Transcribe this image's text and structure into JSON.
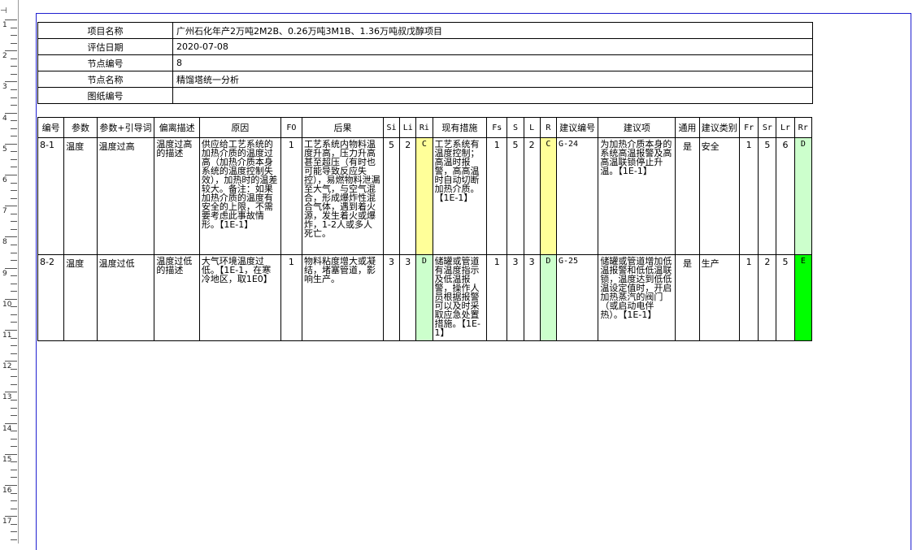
{
  "header": {
    "rows": [
      {
        "label": "项目名称",
        "value": "广州石化年产2万吨2M2B、0.26万吨3M1B、1.36万吨叔戊醇项目"
      },
      {
        "label": "评估日期",
        "value": "2020-07-08"
      },
      {
        "label": "节点编号",
        "value": "8"
      },
      {
        "label": "节点名称",
        "value": "精馏塔统一分析"
      },
      {
        "label": "图纸编号",
        "value": ""
      }
    ]
  },
  "columns": [
    "编号",
    "参数",
    "参数+引导词",
    "偏离描述",
    "原因",
    "FO",
    "后果",
    "Si",
    "Li",
    "Ri",
    "现有措施",
    "Fs",
    "S",
    "L",
    "R",
    "建议编号",
    "建议项",
    "通用",
    "建议类别",
    "Fr",
    "Sr",
    "Lr",
    "Rr"
  ],
  "rows": [
    {
      "id": "8-1",
      "param": "温度",
      "guide": "温度过高",
      "deviation": "温度过高的描述",
      "cause": "供应给工艺系统的加热介质的温度过高（加热介质本身系统的温度控制失效），加热时的温差较大。备注：如果加热介质的温度有安全的上限，不需要考虑此事故情形。【1E-1】",
      "fo": "1",
      "consequence": "工艺系统内物料温度升高，压力升高甚至超压（有时也可能导致反应失控），易燃物料泄漏至大气，与空气混合，形成爆炸性混合气体，遇到着火源，发生着火或爆炸，1-2人或多人死亡。",
      "si": "5",
      "li": "2",
      "ri": "C",
      "measures": "工艺系统有温度控制；高温时报警，高高温时自动切断加热介质。【1E-1】",
      "fs": "1",
      "s": "5",
      "l": "2",
      "r": "C",
      "sugg_no": "G-24",
      "sugg": "为加热介质本身的系统高温报警及高高温联锁停止升温。【1E-1】",
      "general": "是",
      "category": "安全",
      "fr": "1",
      "sr": "5",
      "lr": "6",
      "rr": "D"
    },
    {
      "id": "8-2",
      "param": "温度",
      "guide": "温度过低",
      "deviation": "温度过低的描述",
      "cause": "大气环境温度过低。【1E-1，在寒冷地区，取1E0】",
      "fo": "1",
      "consequence": "物料粘度增大或凝结，堵塞管道，影响生产。",
      "si": "3",
      "li": "3",
      "ri": "D",
      "measures": "储罐或管道有温度指示及低温报警，操作人员根据报警可以及时采取应急处置措施。【1E-1】",
      "fs": "1",
      "s": "3",
      "l": "3",
      "r": "D",
      "sugg_no": "G-25",
      "sugg": "储罐或管道增加低温报警和低低温联锁，温度达到低低温设定值时，开启加热蒸汽的阀门（或启动电伴热）。【1E-1】",
      "general": "是",
      "category": "生产",
      "fr": "1",
      "sr": "2",
      "lr": "5",
      "rr": "E"
    }
  ],
  "colors": {
    "risk_c": "#ffff99",
    "risk_d": "#ccffcc",
    "risk_e": "#00ff00",
    "page_border": "#1f1fd0"
  },
  "ruler": {
    "numbers": [
      "1",
      "2",
      "3",
      "4",
      "5",
      "6",
      "7",
      "8",
      "9",
      "10",
      "11",
      "12",
      "13",
      "14",
      "15",
      "16",
      "17"
    ]
  }
}
